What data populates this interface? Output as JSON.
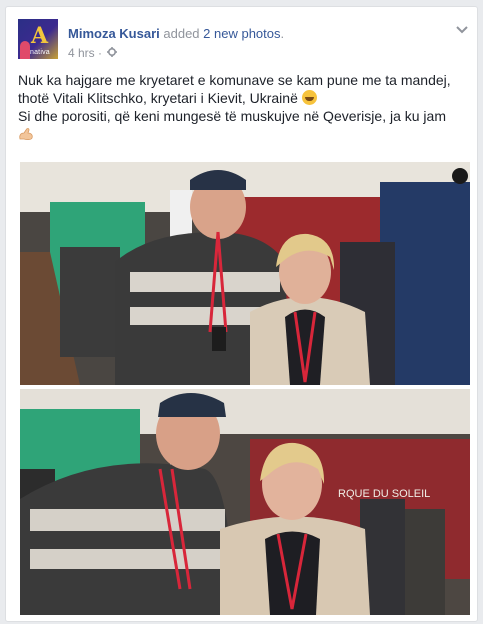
{
  "post": {
    "author": "Mimoza Kusari",
    "action": "added",
    "action_link": "2 new photos",
    "action_end": ".",
    "timestamp": "4 hrs",
    "separator": "·",
    "avatar_label": "A",
    "avatar_sub": "nativa",
    "text_lines": [
      "Nuk ka hajgare me kryetaret e komunave se kam pune me ta mandej,",
      "thotë Vitali Klitschko, kryetari i Kievit, Ukrainë",
      "Si dhe porositi, që keni mungesë të muskujve në Qeverisje, ja ku jam"
    ],
    "photo2_sign": "RQUE DU SOLEIL"
  },
  "icons": {
    "audience": "gear-icon",
    "menu": "chevron-down-icon",
    "emoji1": "grinning-face-icon",
    "emoji2": "flexed-biceps-icon"
  },
  "colors": {
    "link": "#365899",
    "meta": "#90949c",
    "text": "#1d2129"
  }
}
